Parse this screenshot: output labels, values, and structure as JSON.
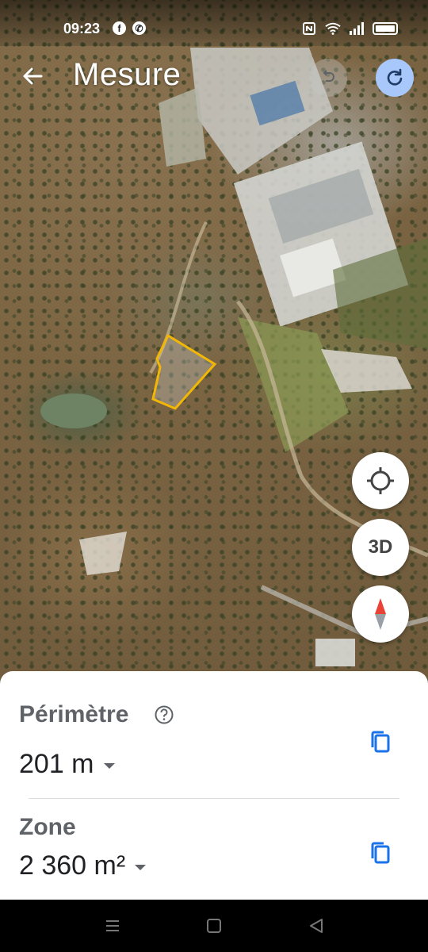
{
  "status_bar": {
    "time": "09:23",
    "left_icons": [
      "facebook-icon",
      "whatsapp-icon"
    ],
    "right_icons": [
      "nfc-icon",
      "wifi-icon",
      "signal-icon",
      "battery-icon"
    ]
  },
  "header": {
    "title": "Mesure",
    "back_icon": "arrow-left-icon",
    "undo_icon": "undo-icon",
    "redo_icon": "redo-icon"
  },
  "map_controls": {
    "locate_icon": "my-location-icon",
    "view_3d_label": "3D",
    "compass_icon": "compass-icon"
  },
  "measurement": {
    "perimeter_label": "Périmètre",
    "perimeter_value": "201 m",
    "area_label": "Zone",
    "area_value": "2 360 m²"
  },
  "colors": {
    "accent": "#1a73e8",
    "redo_bg": "#a8c7fa",
    "polygon": "#f2b705",
    "compass_red": "#ea4335"
  },
  "navbar_icons": [
    "menu-icon",
    "home-icon",
    "back-icon"
  ]
}
